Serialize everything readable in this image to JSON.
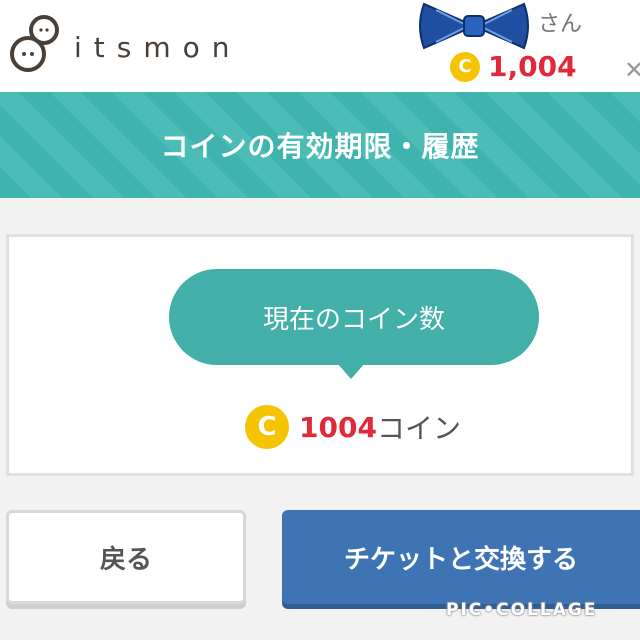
{
  "header": {
    "logo_text": "itsmon",
    "username_suffix": "さん",
    "coin_symbol": "C",
    "coin_balance": "1,004"
  },
  "banner": {
    "title": "コインの有効期限・履歴"
  },
  "card": {
    "bubble_label": "現在のコイン数",
    "coin_symbol": "C",
    "balance_value": "1004",
    "balance_unit": "コイン"
  },
  "buttons": {
    "back_label": "戻る",
    "exchange_label": "チケットと交換する"
  },
  "watermark": "PIC•COLLAGE",
  "colors": {
    "accent_teal": "#42afa8",
    "coin_yellow": "#f5c400",
    "balance_red": "#e02a3a",
    "primary_blue": "#3f74b4"
  },
  "icons": {
    "logo": "pitsmon-logo-icon",
    "bow": "bow-sticker-icon",
    "coin": "coin-icon",
    "close": "close-icon"
  }
}
